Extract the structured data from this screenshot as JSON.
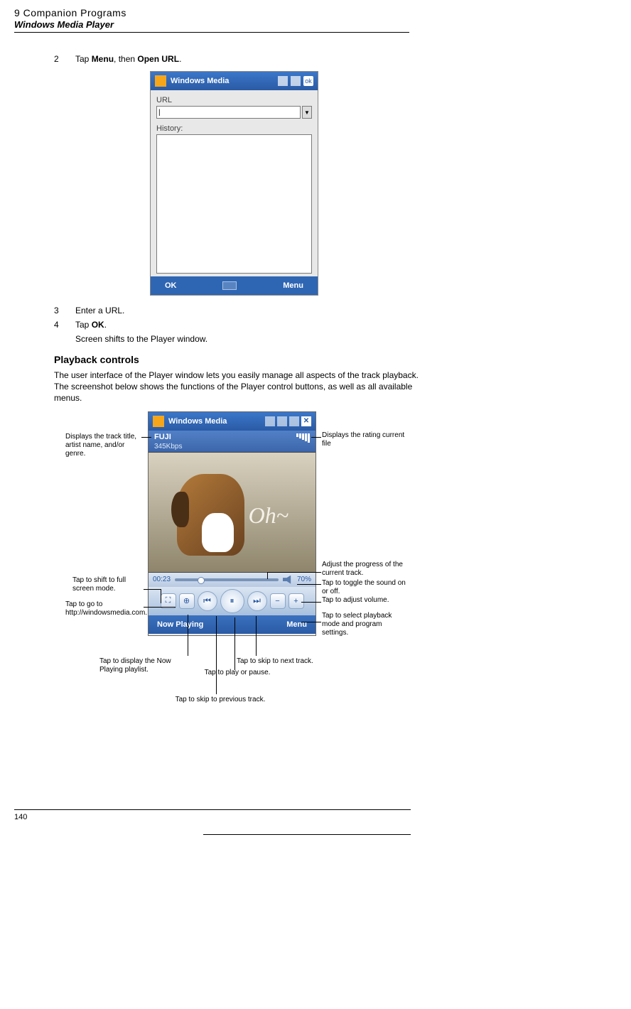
{
  "header": {
    "title": "9 Companion Programs",
    "subtitle": "Windows Media Player"
  },
  "step2": {
    "num": "2",
    "text_prefix": "Tap ",
    "menu": "Menu",
    "text_mid": ", then ",
    "open_url": "Open URL",
    "text_suffix": "."
  },
  "openurl": {
    "app_title": "Windows Media",
    "url_label": "URL",
    "history_label": "History:",
    "softkey_left": "OK",
    "softkey_right": "Menu",
    "ok_btn": "ok"
  },
  "step3": {
    "num": "3",
    "text": "Enter a URL."
  },
  "step4": {
    "num": "4",
    "text_prefix": "Tap ",
    "ok": "OK",
    "text_suffix": ".",
    "result": "Screen shifts to the Player window."
  },
  "playback": {
    "heading": "Playback controls",
    "para": "The user interface of the Player window lets you easily manage all aspects of the track playback. The screenshot below shows the functions of the Player control buttons, as well as all available menus."
  },
  "player": {
    "app_title": "Windows Media",
    "track": "FUJI",
    "bitrate": "345Kbps",
    "oh": "Oh~",
    "elapsed": "00:23",
    "volume_pct": "70%",
    "softkey_left": "Now Playing",
    "softkey_right": "Menu"
  },
  "callouts": {
    "track_info": "Displays the track title, artist name, and/or genre.",
    "rating": "Displays the rating current file",
    "progress": "Adjust the progress of the current track.",
    "mute": "Tap to toggle the sound on or off.",
    "volume": "Tap to adjust volume.",
    "menu": "Tap to select playback mode and program settings.",
    "fullscreen": "Tap to shift to full screen mode.",
    "www": "Tap to go to http://windowsmedia.com.",
    "nowplay": "Tap to display the Now Playing playlist.",
    "prev": "Tap to skip to previous track.",
    "play": "Tap to play or pause.",
    "next": "Tap to skip to next track."
  },
  "page_number": "140"
}
